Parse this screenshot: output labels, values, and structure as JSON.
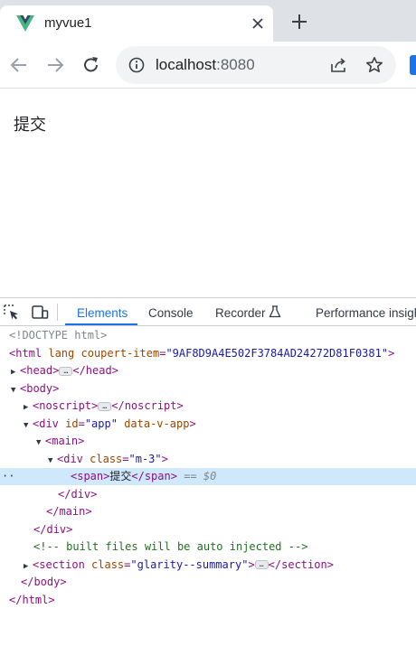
{
  "browser": {
    "tab_title": "myvue1",
    "url_host": "localhost",
    "url_port": ":8080"
  },
  "page": {
    "body_text": "提交"
  },
  "devtools": {
    "tabs": [
      "Elements",
      "Console",
      "Recorder",
      "Performance insigh"
    ],
    "dom": {
      "doctype": "<!DOCTYPE html>",
      "html_open": "<html",
      "html_attr1": "lang",
      "html_attr2": "coupert-item",
      "html_attr2_eq": "=",
      "html_attr2_val": "\"9AF8D9A4E502F3784AD24272D81F0381\"",
      "html_close_bracket": ">",
      "head_open": "<head>",
      "head_close": "</head>",
      "body_open": "<body>",
      "noscript_open": "<noscript>",
      "noscript_close": "</noscript>",
      "div_app_open": "<div",
      "div_app_id_attr": "id",
      "div_app_id_val": "\"app\"",
      "div_app_data_attr": "data-v-app",
      "div_app_gt": ">",
      "main_open": "<main>",
      "div_m3_open": "<div",
      "div_m3_class_attr": "class",
      "div_m3_class_val": "\"m-3\"",
      "div_m3_gt": ">",
      "span_open": "<span>",
      "span_text": "提交",
      "span_close": "</span>",
      "selected_hint": "== $0",
      "div_close": "</div>",
      "main_close": "</main>",
      "div_app_close": "</div>",
      "comment": "<!-- built files will be auto injected -->",
      "section_open": "<section",
      "section_class_attr": "class",
      "section_class_val": "\"glarity--summary\"",
      "section_gt": ">",
      "section_close": "</section>",
      "body_close": "</body>",
      "html_close": "</html>",
      "ellipsis": "…",
      "eq": "=",
      "gutter_dots": "··"
    }
  },
  "colors": {
    "accent": "#1a73e8",
    "selected_row": "#cfe8fc",
    "tag": "#881280",
    "attr": "#994500",
    "attr_value": "#1a1aa6",
    "comment": "#236e25"
  }
}
